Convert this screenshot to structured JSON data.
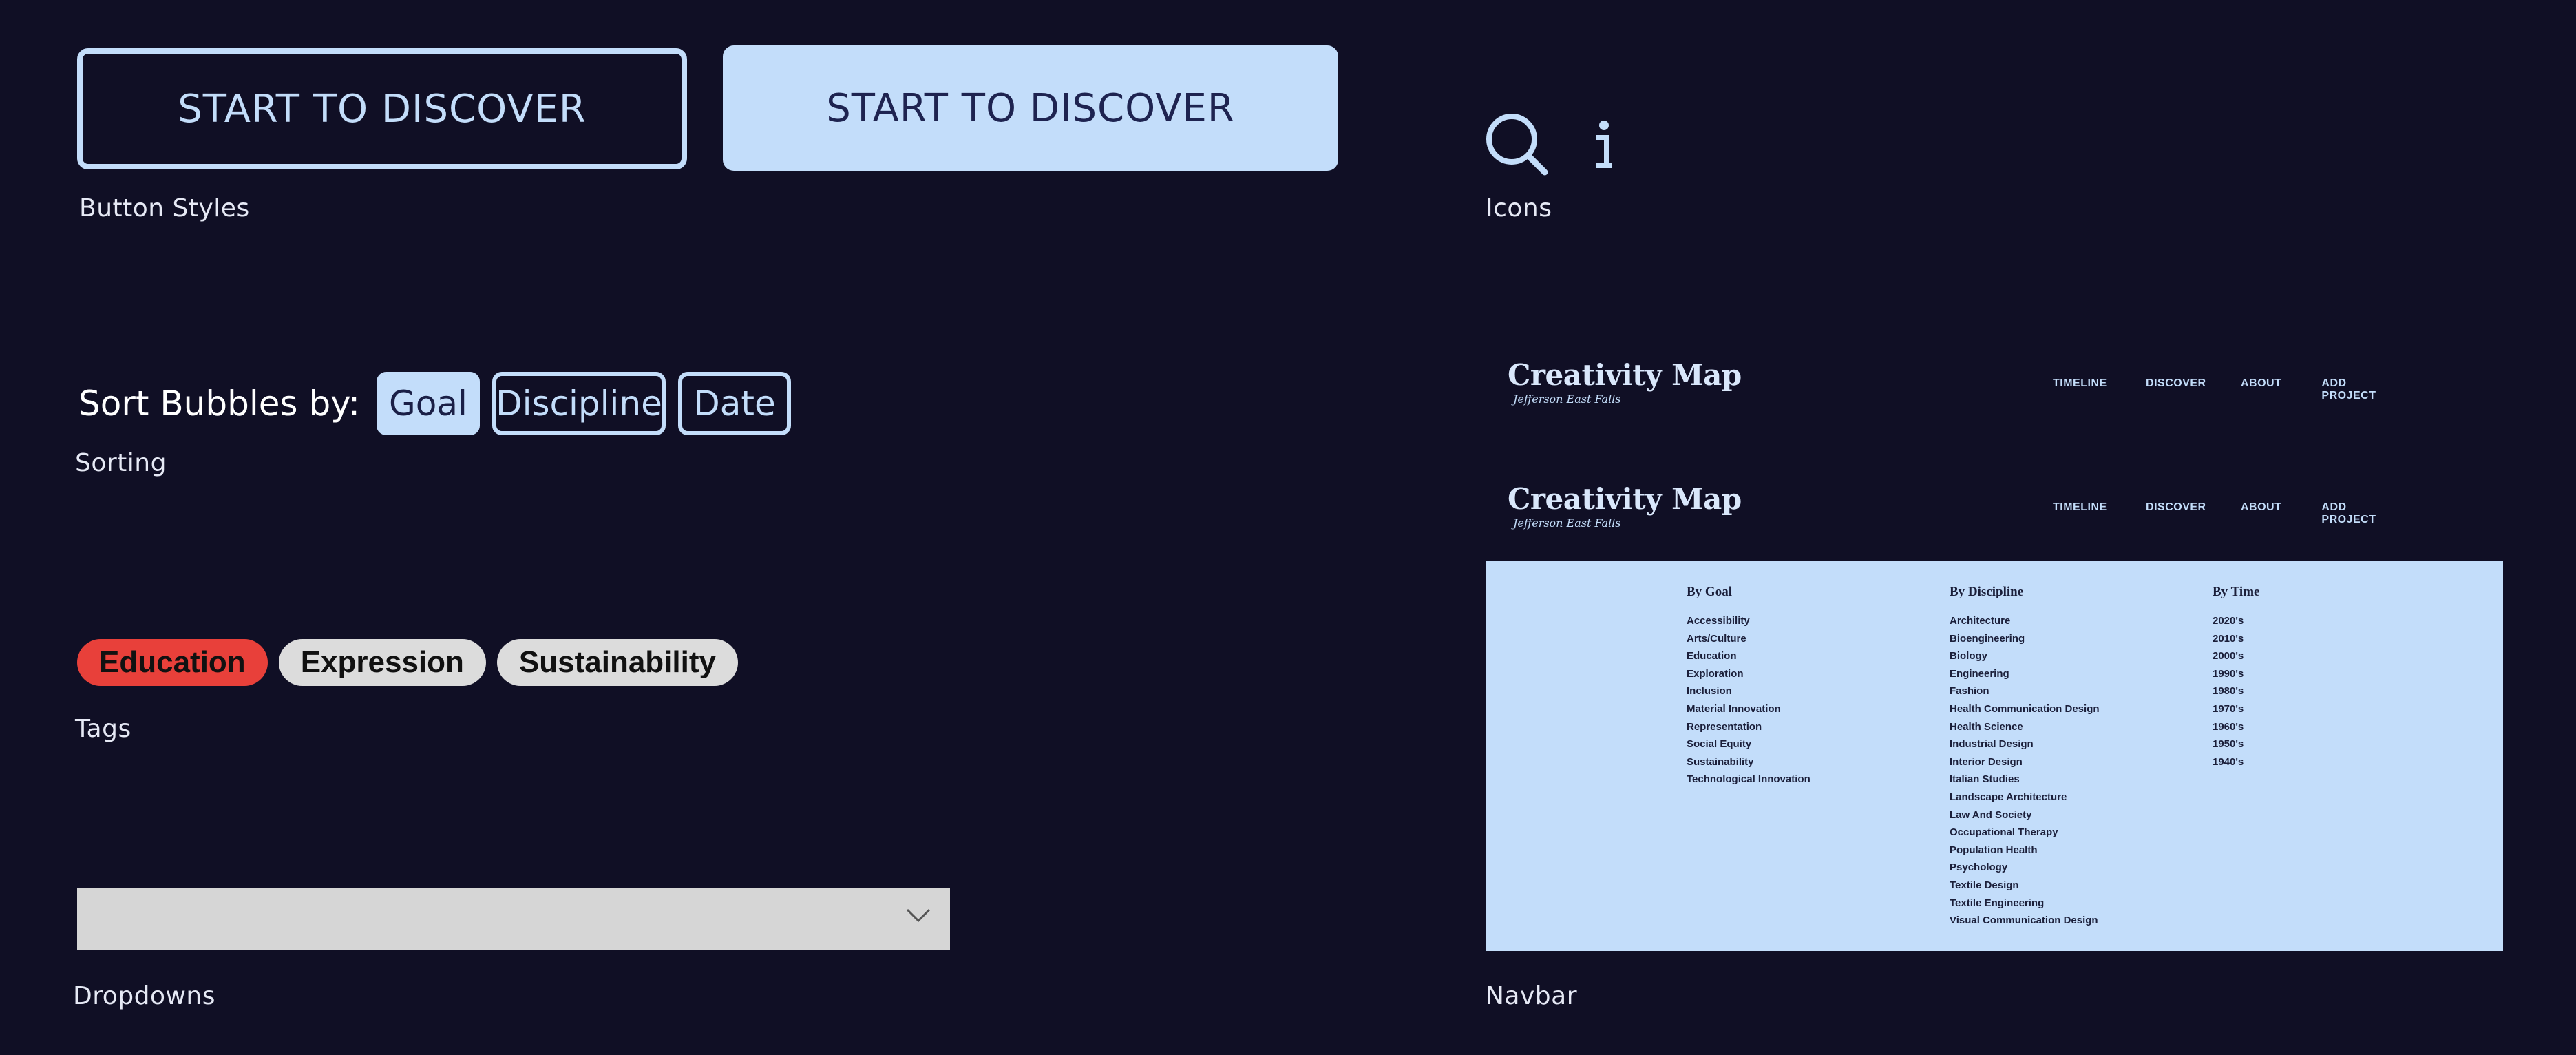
{
  "buttons": {
    "outline_label": "START TO DISCOVER",
    "filled_label": "START TO DISCOVER",
    "caption": "Button Styles"
  },
  "icons": {
    "caption": "Icons",
    "items": [
      "search-icon",
      "info-icon"
    ]
  },
  "sorting": {
    "label": "Sort Bubbles by:",
    "options": [
      "Goal",
      "Discipline",
      "Date"
    ],
    "active": "Goal",
    "caption": "Sorting"
  },
  "tags": {
    "items": [
      "Education",
      "Expression",
      "Sustainability"
    ],
    "caption": "Tags"
  },
  "dropdown": {
    "value": "",
    "caption": "Dropdowns"
  },
  "navbar": {
    "title": "Creativity Map",
    "subtitle": "Jefferson East Falls",
    "links": [
      "TIMELINE",
      "DISCOVER",
      "ABOUT",
      "ADD PROJECT"
    ],
    "caption": "Navbar",
    "menu": {
      "goal_heading": "By Goal",
      "goal_items": [
        "Accessibility",
        "Arts/Culture",
        "Education",
        "Exploration",
        "Inclusion",
        "Material Innovation",
        "Representation",
        "Social Equity",
        "Sustainability",
        "Technological Innovation"
      ],
      "discipline_heading": "By Discipline",
      "discipline_items": [
        "Architecture",
        "Bioengineering",
        "Biology",
        "Engineering",
        "Fashion",
        "Health Communication Design",
        "Health Science",
        "Industrial Design",
        "Interior Design",
        "Italian Studies",
        "Landscape Architecture",
        "Law And Society",
        "Occupational Therapy",
        "Population Health",
        "Psychology",
        "Textile Design",
        "Textile Engineering",
        "Visual Communication Design"
      ],
      "time_heading": "By Time",
      "time_items": [
        "2020's",
        "2010's",
        "2000's",
        "1990's",
        "1980's",
        "1970's",
        "1960's",
        "1950's",
        "1940's"
      ]
    }
  },
  "colors": {
    "background": "#100f25",
    "accent": "#c3ddfa",
    "tag_red": "#e8403a",
    "tag_grey": "#dcdcdc"
  }
}
